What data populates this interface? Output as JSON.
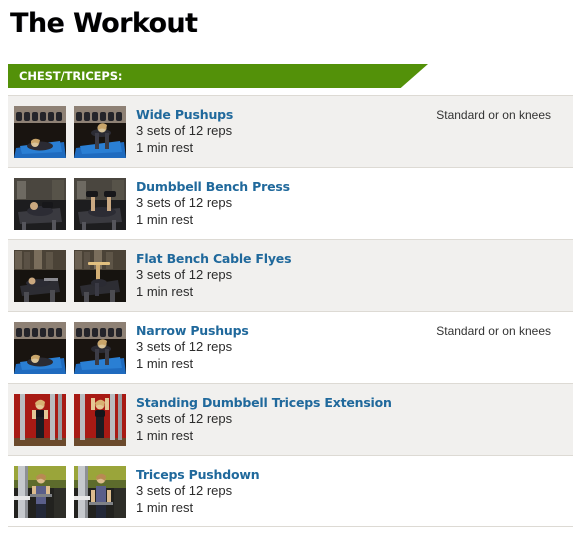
{
  "page": {
    "title": "The Workout"
  },
  "section": {
    "label": "CHEST/TRICEPS:",
    "accent_color": "#539109",
    "label_color": "#ffffff"
  },
  "theme": {
    "link_color": "#20699c",
    "row_shade_color": "#f1f0ee",
    "row_plain_color": "#ffffff",
    "divider_color": "#dddad4",
    "text_color": "#2b2b2b"
  },
  "exercises": [
    {
      "name": "Wide Pushups",
      "sets": "3 sets of 12 reps",
      "rest": "1 min rest",
      "note": "Standard or on knees",
      "shaded": true,
      "thumb_scene": "floor-mat",
      "thumb_alt_start": "wide-pushups-start-thumbnail",
      "thumb_alt_end": "wide-pushups-end-thumbnail"
    },
    {
      "name": "Dumbbell Bench Press",
      "sets": "3 sets of 12 reps",
      "rest": "1 min rest",
      "note": "",
      "shaded": false,
      "thumb_scene": "bench-gym",
      "thumb_alt_start": "dumbbell-bench-press-start-thumbnail",
      "thumb_alt_end": "dumbbell-bench-press-end-thumbnail"
    },
    {
      "name": "Flat Bench Cable Flyes",
      "sets": "3 sets of 12 reps",
      "rest": "1 min rest",
      "note": "",
      "shaded": true,
      "thumb_scene": "cable-gym",
      "thumb_alt_start": "flat-bench-cable-flyes-start-thumbnail",
      "thumb_alt_end": "flat-bench-cable-flyes-end-thumbnail"
    },
    {
      "name": "Narrow Pushups",
      "sets": "3 sets of 12 reps",
      "rest": "1 min rest",
      "note": "Standard or on knees",
      "shaded": false,
      "thumb_scene": "floor-mat",
      "thumb_alt_start": "narrow-pushups-start-thumbnail",
      "thumb_alt_end": "narrow-pushups-end-thumbnail"
    },
    {
      "name": "Standing Dumbbell Triceps Extension",
      "sets": "3 sets of 12 reps",
      "rest": "1 min rest",
      "note": "",
      "shaded": true,
      "thumb_scene": "red-wall",
      "thumb_alt_start": "standing-dumbbell-triceps-extension-start-thumbnail",
      "thumb_alt_end": "standing-dumbbell-triceps-extension-end-thumbnail"
    },
    {
      "name": "Triceps Pushdown",
      "sets": "3 sets of 12 reps",
      "rest": "1 min rest",
      "note": "",
      "shaded": false,
      "thumb_scene": "machine-gym",
      "thumb_alt_start": "triceps-pushdown-start-thumbnail",
      "thumb_alt_end": "triceps-pushdown-end-thumbnail"
    }
  ]
}
